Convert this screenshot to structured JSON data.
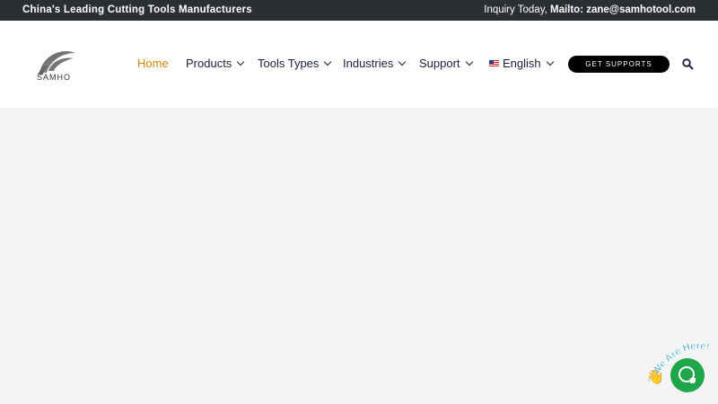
{
  "topbar": {
    "tagline": "China's Leading Cutting Tools Manufacturers",
    "inquiry_prefix": "Inquiry Today, ",
    "inquiry_mailto": "Mailto: zane@samhotool.com"
  },
  "logo": {
    "text": "SAMHO"
  },
  "nav": {
    "home": "Home",
    "products": "Products",
    "tools_types": "Tools Types",
    "industries": "Industries",
    "support": "Support",
    "language": "English"
  },
  "cta": {
    "label": "GET SUPPORTS"
  },
  "chat": {
    "badge_text": "We Are Here!"
  },
  "colors": {
    "accent": "#d4860b",
    "topbar": "#2b2f33",
    "chat_green": "#1fa64a",
    "nav_text": "#1a1f3a"
  }
}
